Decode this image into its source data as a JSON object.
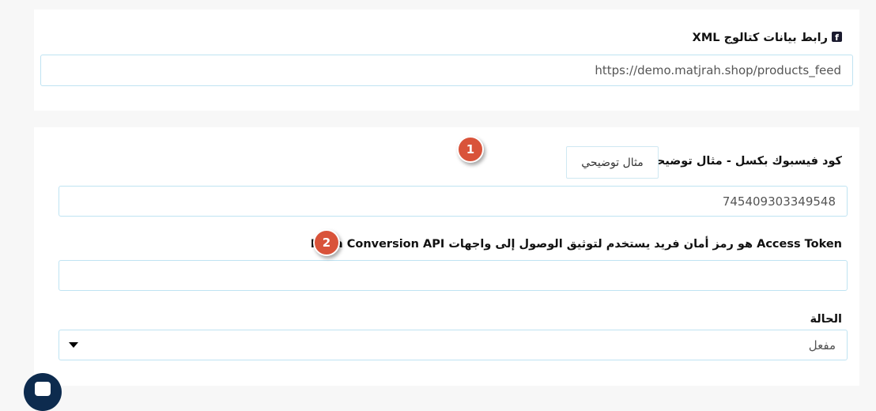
{
  "xml_section": {
    "icon": "facebook-square-icon",
    "label": "رابط بيانات كتالوج XML",
    "url_value": "https://demo.matjrah.shop/products_feed"
  },
  "pixel_section": {
    "pixel_label": "كود فيسبوك بكسل - مثال توضيحي:",
    "example_button": "مثال توضيحي",
    "pixel_value": "745409303349548",
    "token_label": "Access Token هو رمز أمان فريد يستخدم لتوثيق الوصول إلى واجهات Meta Conversion API",
    "token_value": "",
    "status_label": "الحالة",
    "status_selected": "مفعل"
  },
  "badges": {
    "first": "1",
    "second": "2"
  },
  "colors": {
    "badge": "#d9533a",
    "field_border": "#bfe3f2",
    "chat_bubble": "#0d2b4e"
  }
}
